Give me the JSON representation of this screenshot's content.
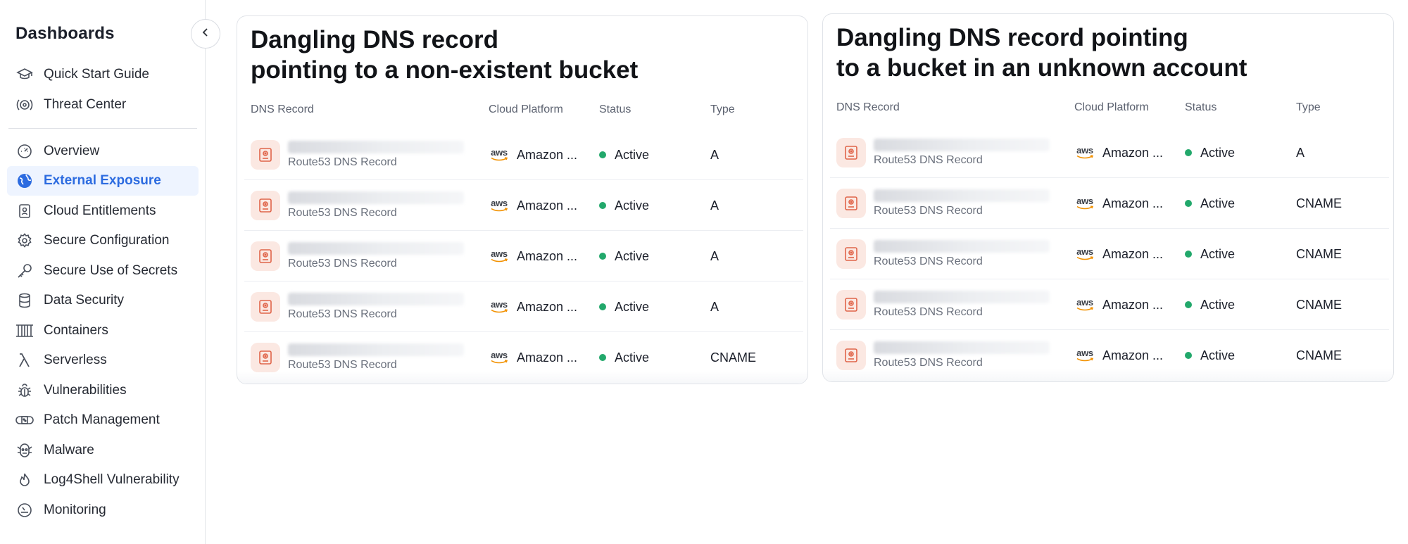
{
  "sidebar": {
    "title": "Dashboards",
    "top_items": [
      {
        "label": "Quick Start Guide",
        "icon": "graduation-cap-icon"
      },
      {
        "label": "Threat Center",
        "icon": "radar-icon"
      }
    ],
    "items": [
      {
        "label": "Overview",
        "icon": "gauge-icon"
      },
      {
        "label": "External Exposure",
        "icon": "globe-icon",
        "active": true
      },
      {
        "label": "Cloud Entitlements",
        "icon": "id-badge-icon"
      },
      {
        "label": "Secure Configuration",
        "icon": "gear-icon"
      },
      {
        "label": "Secure Use of Secrets",
        "icon": "key-icon"
      },
      {
        "label": "Data Security",
        "icon": "database-icon"
      },
      {
        "label": "Containers",
        "icon": "container-icon"
      },
      {
        "label": "Serverless",
        "icon": "lambda-icon"
      },
      {
        "label": "Vulnerabilities",
        "icon": "bug-icon"
      },
      {
        "label": "Patch Management",
        "icon": "patch-icon"
      },
      {
        "label": "Malware",
        "icon": "malware-icon"
      },
      {
        "label": "Log4Shell Vulnerability",
        "icon": "flame-icon"
      },
      {
        "label": "Monitoring",
        "icon": "monitor-gauge-icon"
      }
    ]
  },
  "columns": {
    "dns_record": "DNS Record",
    "cloud_platform": "Cloud Platform",
    "status": "Status",
    "type": "Type"
  },
  "cards": [
    {
      "title_line1": "Dangling DNS record",
      "title_line2": "pointing to a non-existent bucket",
      "rows": [
        {
          "sub": "Route53 DNS Record",
          "platform": "Amazon ...",
          "status": "Active",
          "type": "A"
        },
        {
          "sub": "Route53 DNS Record",
          "platform": "Amazon ...",
          "status": "Active",
          "type": "A"
        },
        {
          "sub": "Route53 DNS Record",
          "platform": "Amazon ...",
          "status": "Active",
          "type": "A"
        },
        {
          "sub": "Route53 DNS Record",
          "platform": "Amazon ...",
          "status": "Active",
          "type": "A"
        },
        {
          "sub": "Route53 DNS Record",
          "platform": "Amazon ...",
          "status": "Active",
          "type": "CNAME"
        }
      ]
    },
    {
      "title_line1": "Dangling DNS record pointing",
      "title_line2": "to a bucket in an unknown account",
      "rows": [
        {
          "sub": "Route53 DNS Record",
          "platform": "Amazon ...",
          "status": "Active",
          "type": "A"
        },
        {
          "sub": "Route53 DNS Record",
          "platform": "Amazon ...",
          "status": "Active",
          "type": "CNAME"
        },
        {
          "sub": "Route53 DNS Record",
          "platform": "Amazon ...",
          "status": "Active",
          "type": "CNAME"
        },
        {
          "sub": "Route53 DNS Record",
          "platform": "Amazon ...",
          "status": "Active",
          "type": "CNAME"
        },
        {
          "sub": "Route53 DNS Record",
          "platform": "Amazon ...",
          "status": "Active",
          "type": "CNAME"
        }
      ]
    }
  ],
  "aws_logo_text": "aws",
  "colors": {
    "active_nav": "#2c6be0",
    "active_nav_bg": "#eef4ff",
    "status_active": "#22a86b",
    "record_icon": "#e0654a",
    "record_icon_bg": "#fbe8e2",
    "aws_smile": "#f29100"
  }
}
